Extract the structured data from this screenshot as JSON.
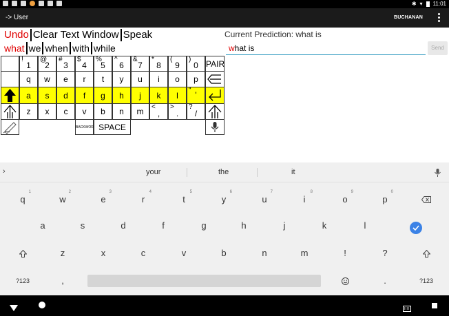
{
  "status_bar": {
    "time": "11:01"
  },
  "appbar": {
    "title": "-> User",
    "user": "BUCHANAN"
  },
  "controls": {
    "row1": [
      "Undo",
      "Clear Text Window",
      "Speak"
    ],
    "row2": [
      "what",
      "we",
      "when",
      "with",
      "while"
    ]
  },
  "prediction": {
    "label": "Current Prediction: what is",
    "first_char": "w",
    "rest": "hat is",
    "send_label": "Send"
  },
  "grid": {
    "row1": [
      {
        "sup": "!",
        "main": "1"
      },
      {
        "sup": "@",
        "main": "2"
      },
      {
        "sup": "#",
        "main": "3"
      },
      {
        "sup": "$",
        "main": "4"
      },
      {
        "sup": "%",
        "main": "5"
      },
      {
        "sup": "^",
        "main": "6"
      },
      {
        "sup": "&",
        "main": "7"
      },
      {
        "sup": "*",
        "main": "8"
      },
      {
        "sup": "(",
        "main": "9"
      },
      {
        "sup": ")",
        "main": "0"
      },
      {
        "sup": "",
        "main": "PAIR"
      }
    ],
    "row2": [
      "q",
      "w",
      "e",
      "r",
      "t",
      "y",
      "u",
      "i",
      "o",
      "p"
    ],
    "row3": [
      "a",
      "s",
      "d",
      "f",
      "g",
      "h",
      "j",
      "k",
      "l"
    ],
    "row3_extra": {
      "sup": "\"",
      "main": "'"
    },
    "row4": [
      "z",
      "x",
      "c",
      "v",
      "b",
      "n",
      "m"
    ],
    "row4_punct": [
      {
        "sup": "<",
        "main": ","
      },
      {
        "sup": ">",
        "main": "."
      },
      {
        "sup": "?",
        "main": "/"
      }
    ],
    "backword": "BACKWORD",
    "space": "SPACE"
  },
  "suggestions": [
    "your",
    "the",
    "it"
  ],
  "soft_keyboard": {
    "row1": [
      {
        "k": "q",
        "h": "1"
      },
      {
        "k": "w",
        "h": "2"
      },
      {
        "k": "e",
        "h": "3"
      },
      {
        "k": "r",
        "h": "4"
      },
      {
        "k": "t",
        "h": "5"
      },
      {
        "k": "y",
        "h": "6"
      },
      {
        "k": "u",
        "h": "7"
      },
      {
        "k": "i",
        "h": "8"
      },
      {
        "k": "o",
        "h": "9"
      },
      {
        "k": "p",
        "h": "0"
      }
    ],
    "row2": [
      "a",
      "s",
      "d",
      "f",
      "g",
      "h",
      "j",
      "k",
      "l"
    ],
    "row3": [
      "z",
      "x",
      "c",
      "v",
      "b",
      "n",
      "m",
      "!",
      "?"
    ],
    "sym_left": "?123",
    "comma": ",",
    "period": ".",
    "sym_right": "?123"
  }
}
